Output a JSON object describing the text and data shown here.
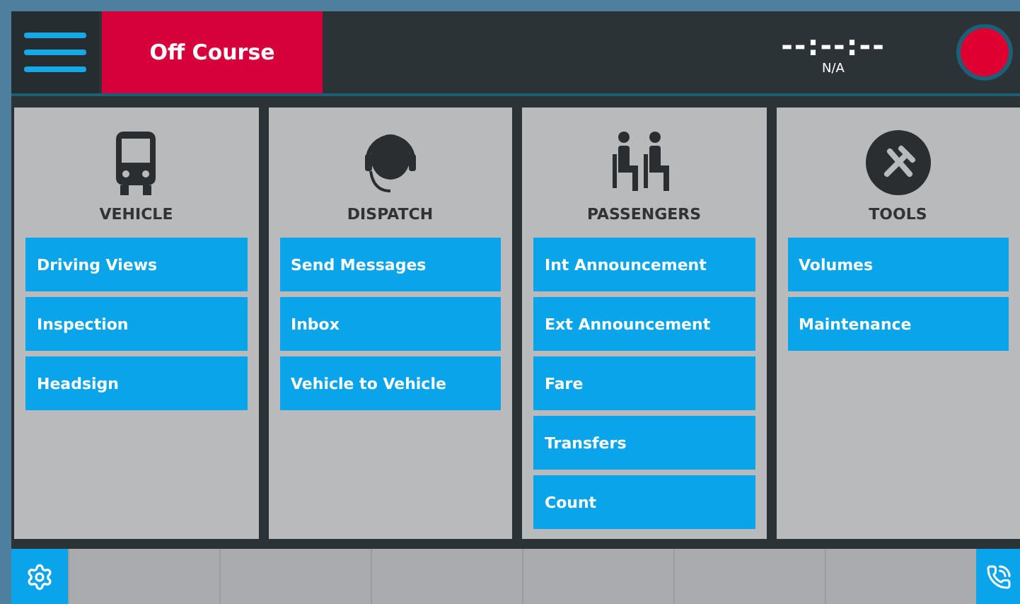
{
  "top_bar": {
    "status": "Off Course",
    "clock": "--:--:--",
    "clock_label": "N/A"
  },
  "panels": [
    {
      "kind": "vehicle",
      "title": "VEHICLE",
      "items": [
        "Driving Views",
        "Inspection",
        "Headsign"
      ]
    },
    {
      "kind": "dispatch",
      "title": "DISPATCH",
      "items": [
        "Send Messages",
        "Inbox",
        "Vehicle to Vehicle"
      ]
    },
    {
      "kind": "passengers",
      "title": "PASSENGERS",
      "items": [
        "Int Announcement",
        "Ext Announcement",
        "Fare",
        "Transfers",
        "Count"
      ]
    },
    {
      "kind": "tools",
      "title": "TOOLS",
      "items": [
        "Volumes",
        "Maintenance"
      ]
    }
  ]
}
